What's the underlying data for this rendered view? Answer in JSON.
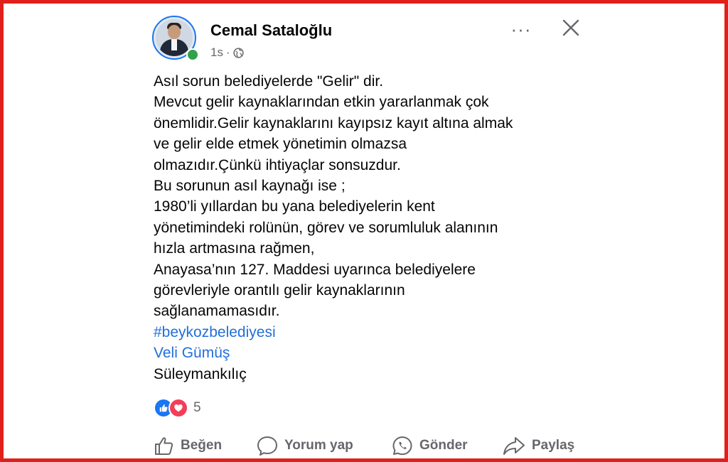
{
  "post": {
    "author": "Cemal Sataloğlu",
    "time": "1s",
    "separator": "·",
    "more_label": "···",
    "lines": [
      "Asıl sorun belediyelerde  \"Gelir\" dir.",
      "Mevcut gelir kaynaklarından etkin yararlanmak çok",
      "önemlidir.Gelir kaynaklarını kayıpsız kayıt altına almak",
      "ve gelir elde etmek  yönetimin olmazsa",
      "olmazıdır.Çünkü ihtiyaçlar sonsuzdur.",
      "Bu sorunun asıl kaynağı ise ;",
      "1980’li yıllardan bu yana belediyelerin kent",
      "yönetimindeki rolünün, görev ve sorumluluk alanının",
      "hızla artmasına rağmen,",
      "Anayasa’nın 127. Maddesi uyarınca belediyelere",
      "görevleriyle orantılı gelir kaynaklarının",
      "sağlanamamasıdır."
    ],
    "hashtag": "#beykozbelediyesi",
    "tagged": "Veli Gümüş",
    "last_line": "Süleymankılıç",
    "reaction_count": "5",
    "reactions": [
      "like-icon",
      "love-icon"
    ]
  },
  "actions": {
    "like": "Beğen",
    "comment": "Yorum yap",
    "send": "Gönder",
    "share": "Paylaş"
  },
  "colors": {
    "frame": "#e0201b",
    "link": "#216fdb",
    "like": "#1877f2",
    "love": "#f33e58",
    "online": "#31a24c",
    "secondary_text": "#65676b"
  }
}
